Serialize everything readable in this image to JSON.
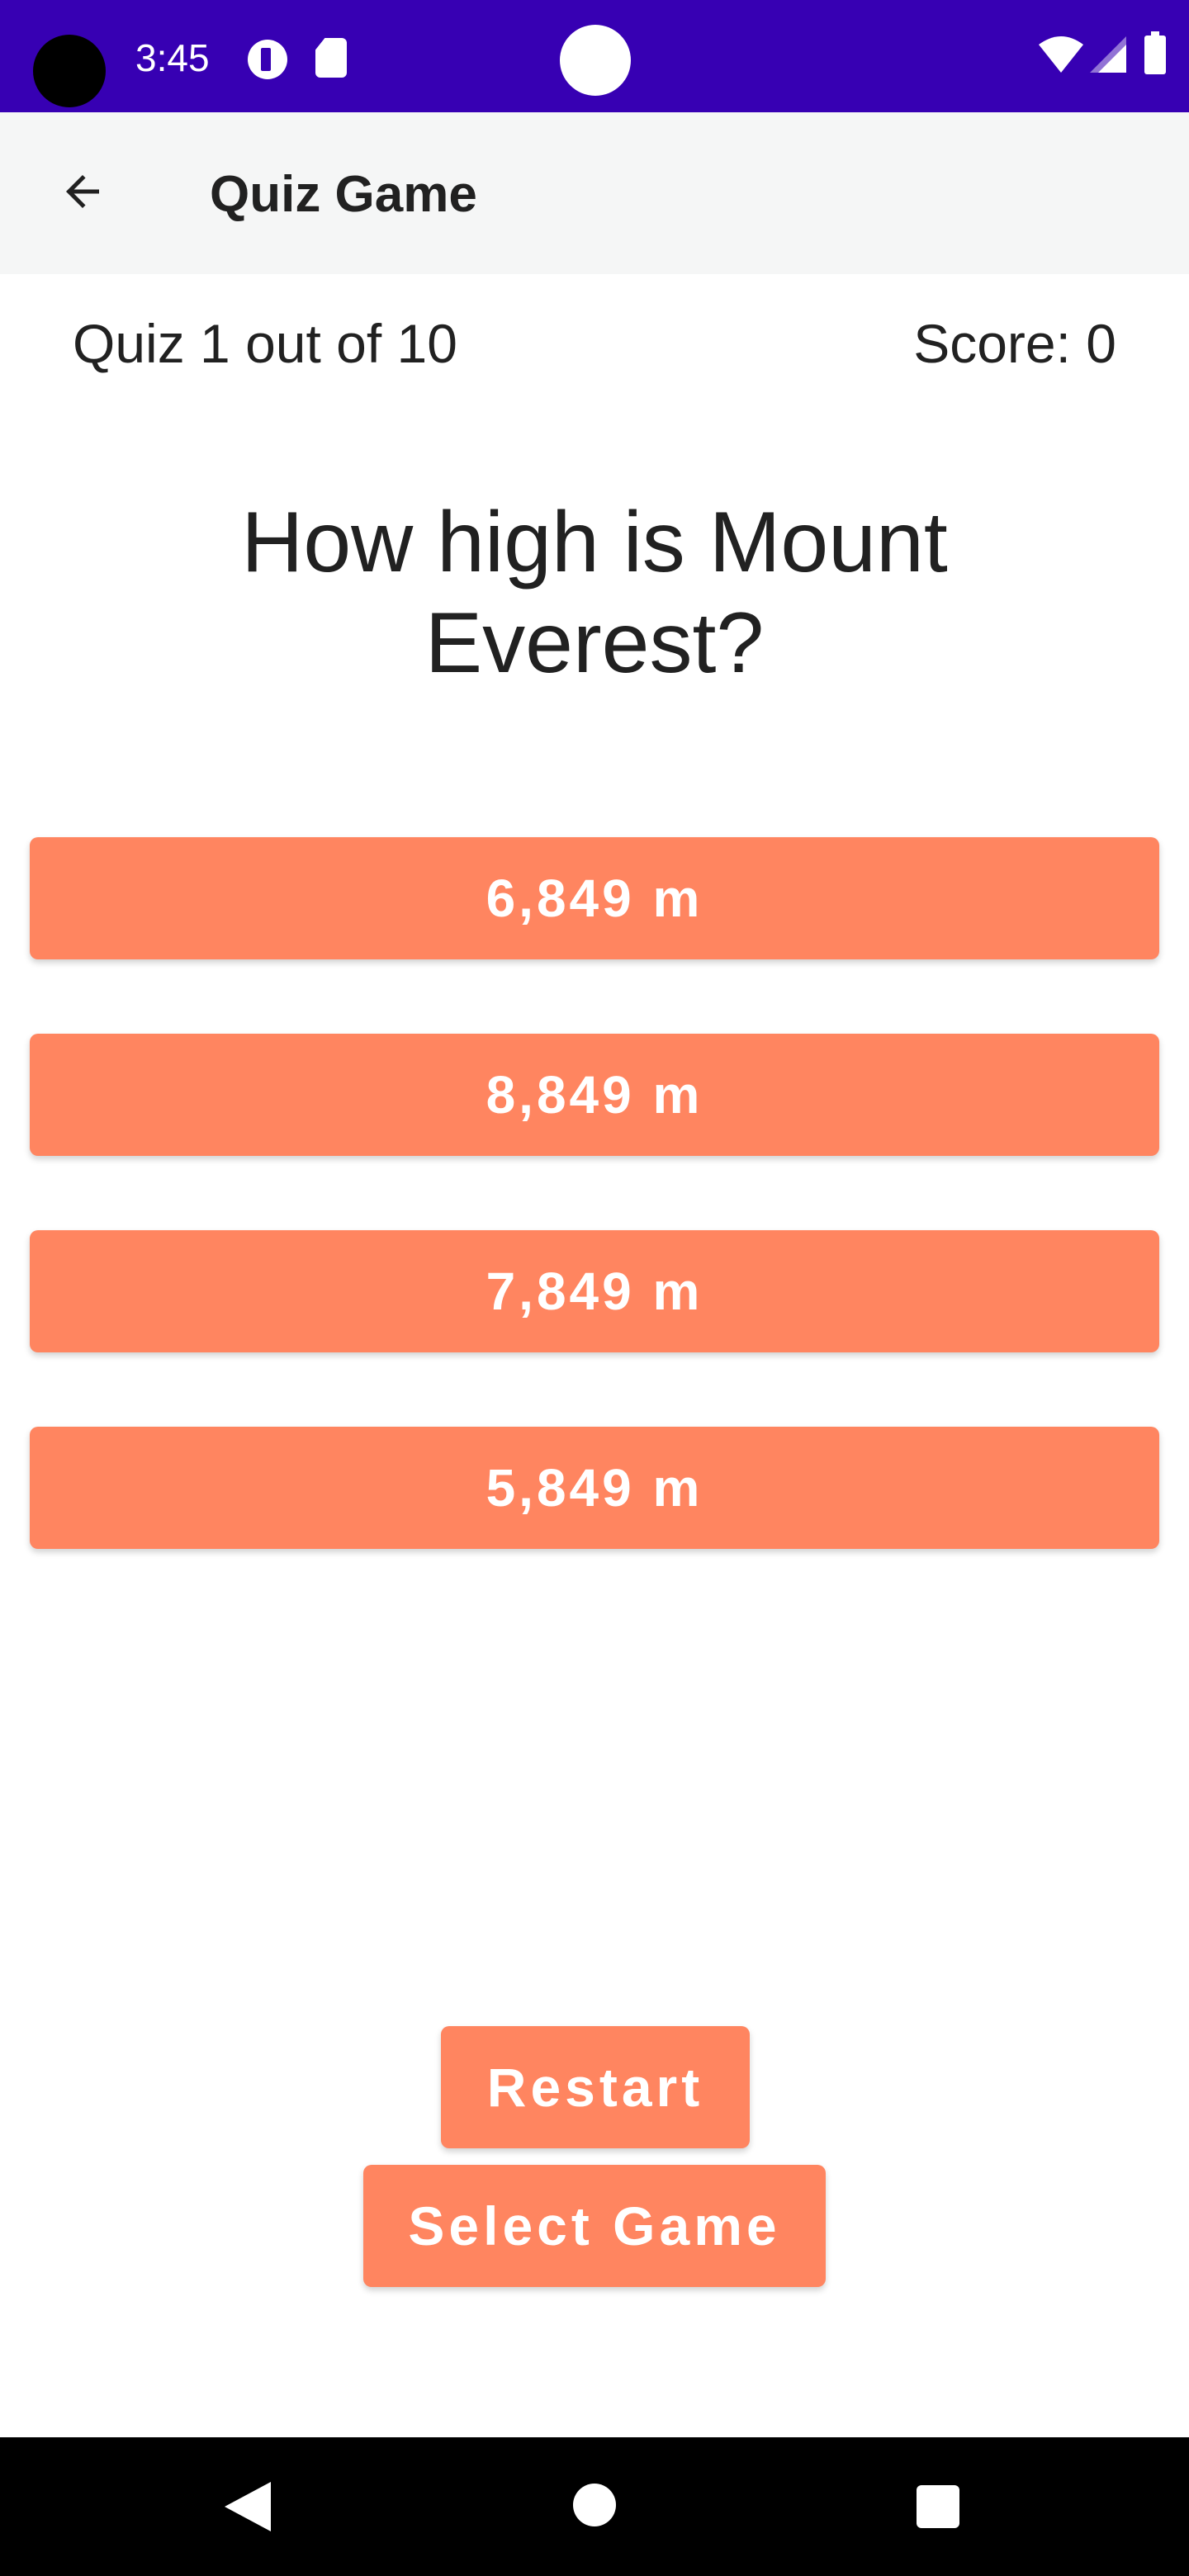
{
  "status_bar": {
    "time": "3:45",
    "icons": [
      "notification-icon",
      "sd-card-icon",
      "wifi-icon",
      "signal-icon",
      "battery-icon"
    ]
  },
  "app_bar": {
    "title": "Quiz Game",
    "back_icon": "arrow-back-icon"
  },
  "info": {
    "progress": "Quiz 1 out of 10",
    "score": "Score: 0"
  },
  "question": "How high is Mount Everest?",
  "answers": [
    {
      "label": "6,849 m"
    },
    {
      "label": "8,849 m"
    },
    {
      "label": "7,849 m"
    },
    {
      "label": "5,849 m"
    }
  ],
  "actions": {
    "restart_label": "Restart",
    "select_game_label": "Select Game"
  },
  "nav_bar": {
    "icons": [
      "nav-back-icon",
      "nav-home-icon",
      "nav-recents-icon"
    ]
  },
  "colors": {
    "status_bar": "#3700b3",
    "app_bar": "#f5f6f6",
    "button": "#ff8560",
    "button_text": "#ffffff",
    "text": "#212121",
    "nav_bar": "#000000"
  }
}
